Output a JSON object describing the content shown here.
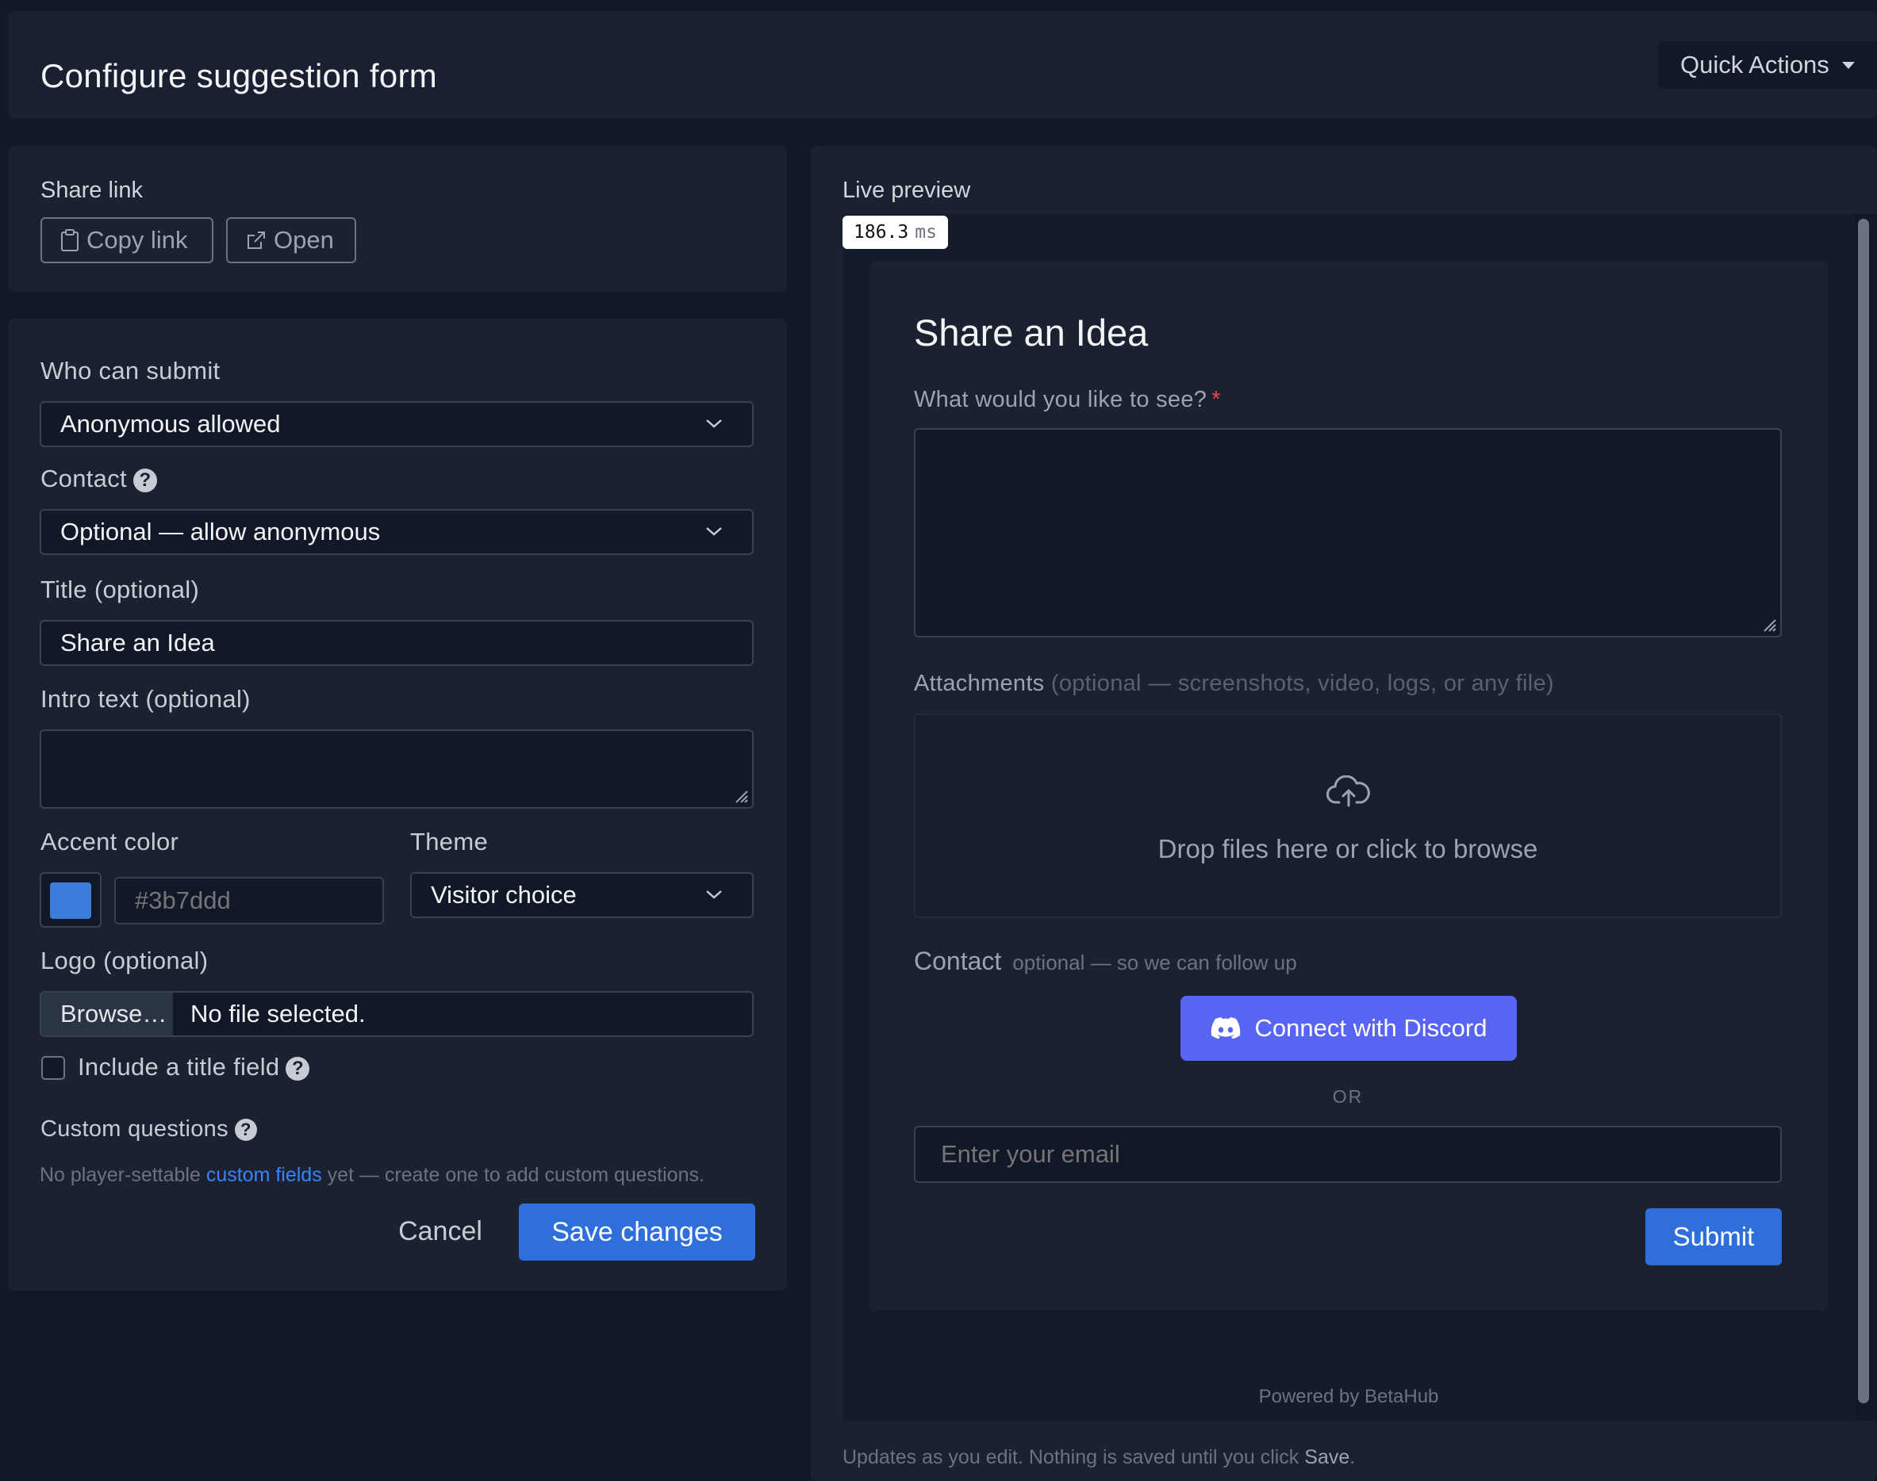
{
  "header": {
    "title": "Configure suggestion form",
    "quick_actions": "Quick Actions"
  },
  "share": {
    "label": "Share link",
    "copy_label": "Copy link",
    "open_label": "Open"
  },
  "settings": {
    "who_label": "Who can submit",
    "who_value": "Anonymous allowed",
    "contact_label": "Contact",
    "contact_value": "Optional — allow anonymous",
    "title_label": "Title (optional)",
    "title_value": "Share an Idea",
    "intro_label": "Intro text (optional)",
    "accent_label": "Accent color",
    "accent_color": "#3b7ddd",
    "accent_placeholder": "#3b7ddd",
    "theme_label": "Theme",
    "theme_value": "Visitor choice",
    "logo_label": "Logo (optional)",
    "browse_label": "Browse…",
    "file_status": "No file selected.",
    "include_title_label": "Include a title field",
    "include_title_checked": false,
    "custom_questions_label": "Custom questions",
    "cq_hint_pre": "No player-settable ",
    "cq_hint_link": "custom fields",
    "cq_hint_post": " yet — create one to add custom questions.",
    "cancel_label": "Cancel",
    "save_label": "Save changes"
  },
  "preview": {
    "label": "Live preview",
    "timing_value": "186.3",
    "timing_unit": "ms",
    "form_title": "Share an Idea",
    "question_label": "What would you like to see?",
    "required_mark": "*",
    "attachments_label": "Attachments",
    "attachments_hint": "(optional — screenshots, video, logs, or any file)",
    "drop_text": "Drop files here or click to browse",
    "contact_label": "Contact",
    "contact_hint": "optional — so we can follow up",
    "discord_label": "Connect with Discord",
    "or_label": "OR",
    "email_placeholder": "Enter your email",
    "submit_label": "Submit",
    "powered_by": "Powered by BetaHub",
    "hint_pre": "Updates as you edit. Nothing is saved until you click ",
    "hint_bold": "Save",
    "hint_post": "."
  },
  "colors": {
    "page_bg": "#111827",
    "card_bg": "#1a2232",
    "primary": "#2f6fdc",
    "discord": "#5865f2",
    "link": "#3b82f6",
    "required": "#ef4444"
  }
}
